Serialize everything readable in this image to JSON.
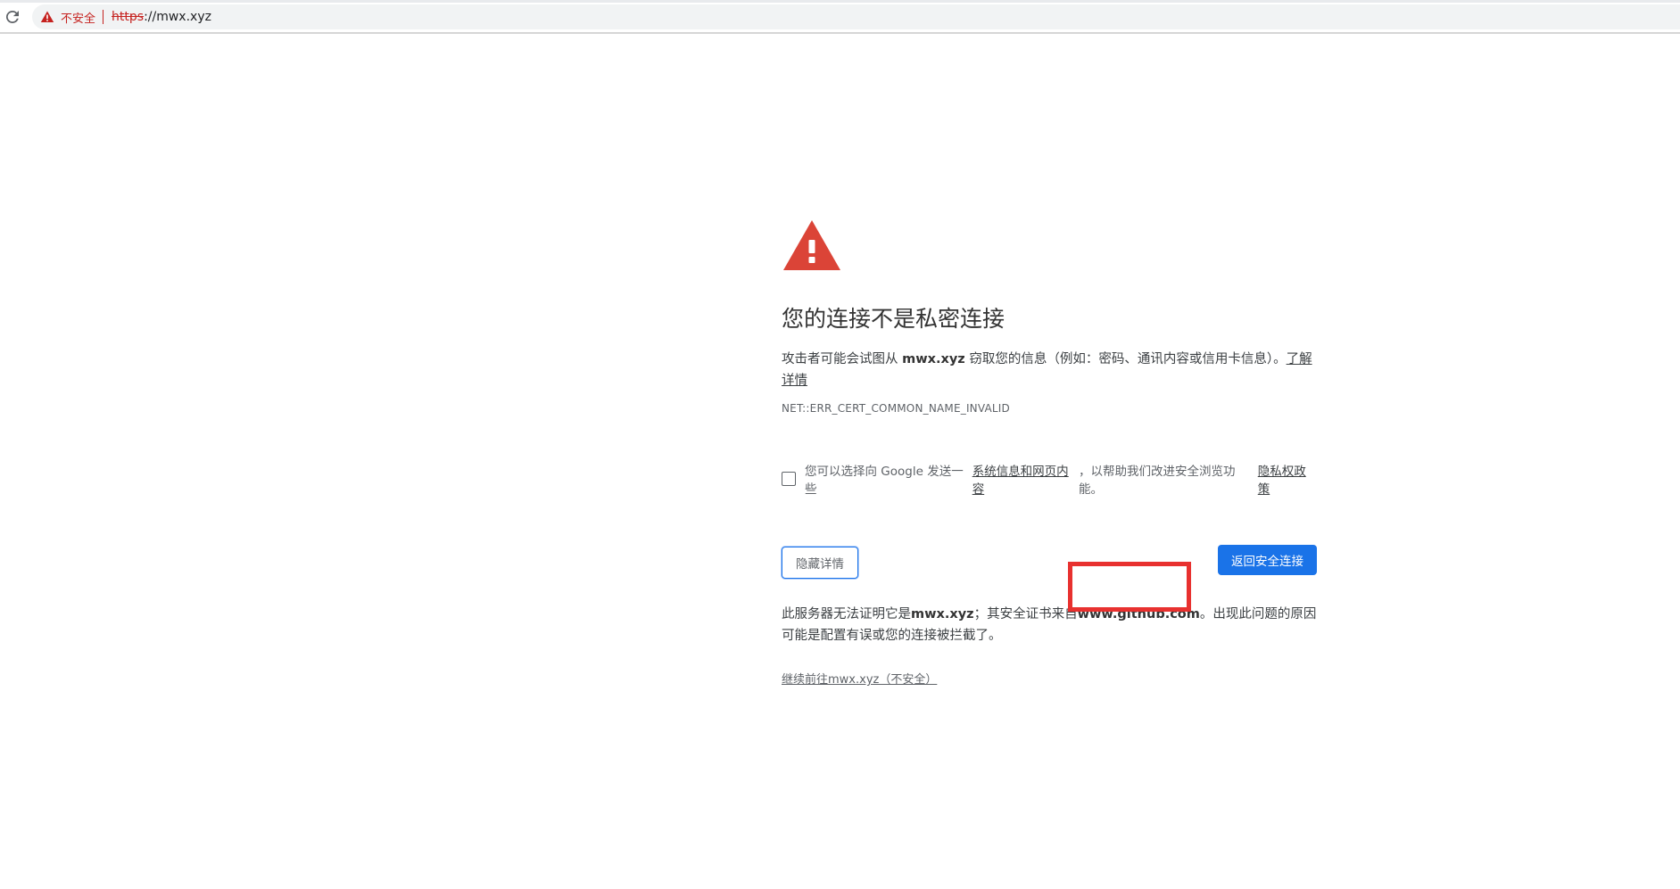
{
  "browser": {
    "not_secure_label": "不安全",
    "url_scheme": "https",
    "url_sep": "://",
    "url_host": "mwx.xyz",
    "reload_icon": "reload-icon",
    "warning_icon": "warning-triangle-icon"
  },
  "interstitial": {
    "icon": "large-warning-triangle-icon",
    "heading": "您的连接不是私密连接",
    "explanation_pre": "攻击者可能会试图从 ",
    "explanation_host": "mwx.xyz",
    "explanation_post": " 窃取您的信息（例如：密码、通讯内容或信用卡信息）。",
    "learn_more": "了解详情",
    "error_code": "NET::ERR_CERT_COMMON_NAME_INVALID",
    "optin_pre": "您可以选择向 Google 发送一些",
    "optin_link": "系统信息和网页内容",
    "optin_post": "，以帮助我们改进安全浏览功能。",
    "privacy_link": "隐私权政策",
    "hide_details_button": "隐藏详情",
    "back_to_safety_button": "返回安全连接",
    "details_pre": "此服务器无法证明它是",
    "details_host": "mwx.xyz",
    "details_mid": "；其安全证书来自",
    "details_cert_host": "www.github.com",
    "details_post": "。出现此问题的原因可能是配置有误或您的连接被拦截了。",
    "proceed_link": "继续前往mwx.xyz（不安全）"
  },
  "colors": {
    "danger": "#c5221f",
    "primary_blue": "#1a73e8",
    "warning_red": "#db4437",
    "annotation_red": "#e8312f"
  }
}
